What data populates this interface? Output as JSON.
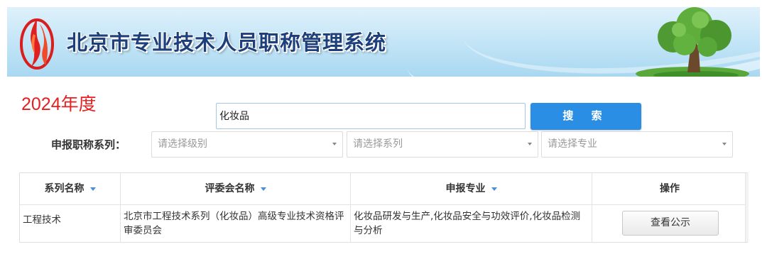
{
  "banner": {
    "title": "北京市专业技术人员职称管理系统",
    "logo_icon": "red-flame-logo-icon",
    "tree_icon": "tree-icon",
    "colors": {
      "title": "#1d3f7c",
      "banner_bg": "#c6e6f7"
    }
  },
  "year_label": "2024年度",
  "search": {
    "value": "化妆品",
    "button_label": "搜 索",
    "button_color": "#2b8ee5"
  },
  "filters": {
    "label": "申报职称系列：",
    "level_placeholder": "请选择级别",
    "series_placeholder": "请选择系列",
    "major_placeholder": "请选择专业"
  },
  "table": {
    "headers": [
      "系列名称",
      "评委会名称",
      "申报专业",
      "操作"
    ],
    "rows": [
      {
        "series": "工程技术",
        "committee": "北京市工程技术系列（化妆品）高级专业技术资格评审委员会",
        "major": "化妆品研发与生产,化妆品安全与功效评价,化妆品检测与分析",
        "action_label": "查看公示"
      }
    ]
  }
}
